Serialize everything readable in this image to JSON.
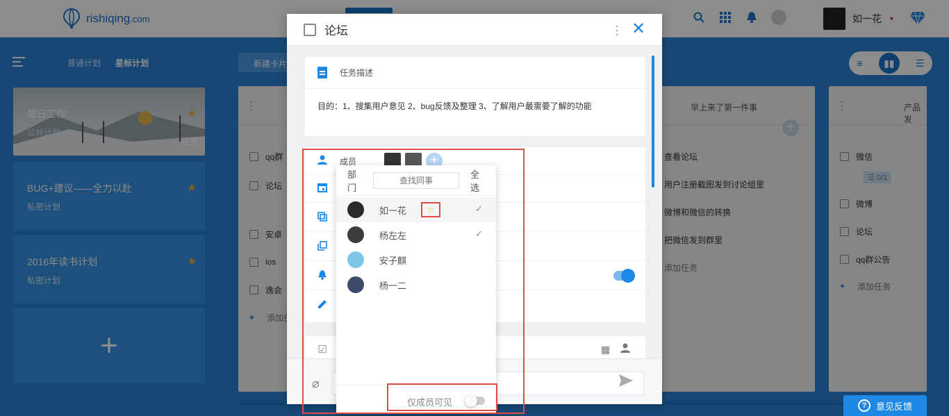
{
  "brand": {
    "name": "rishiqing",
    "suffix": ".com"
  },
  "user": {
    "name": "如一花"
  },
  "sidebar": {
    "tabs": [
      "普通计划",
      "星标计划"
    ],
    "plans": [
      {
        "title": "每日工作",
        "sub": "公共计划",
        "action": "设置"
      },
      {
        "title": "BUG+建议——全力以赴",
        "sub": "私密计划"
      },
      {
        "title": "2016年读书计划",
        "sub": "私密计划"
      }
    ],
    "add": "+"
  },
  "board": {
    "new_card": "新建卡片",
    "columns": [
      {
        "title": "",
        "tasks": [
          "qq群",
          "论坛",
          "安卓",
          "ios",
          "逸会"
        ],
        "add": "添加任务"
      },
      {
        "title": "早上来了第一件事",
        "tasks": [
          "查看论坛",
          "用户注册截图发到讨论组里",
          "微博和微信的转换",
          "把微信发到群里"
        ],
        "add": "添加任务"
      },
      {
        "title": "产品发",
        "tasks": [
          "微信",
          "微博",
          "论坛",
          "qq群公告"
        ],
        "tag": "0/1",
        "add": "添加任务"
      }
    ]
  },
  "modal": {
    "title": "论坛",
    "desc_label": "任务描述",
    "desc_text": "目的：1、搜集用户意见 2、bug反馈及整理 3、了解用户最需要了解的功能",
    "member_label": "成员"
  },
  "dropdown": {
    "dept": "部门",
    "search_placeholder": "查找同事",
    "select_all": "全选",
    "members": [
      {
        "name": "如一花",
        "checked": true,
        "star": true,
        "avatar_color": "#2a2a2a"
      },
      {
        "name": "杨左左",
        "checked": true,
        "star": false,
        "avatar_color": "#3b3b3b"
      },
      {
        "name": "安子麒",
        "checked": false,
        "star": false,
        "avatar_color": "#7ec6e8"
      },
      {
        "name": "杨一二",
        "checked": false,
        "star": false,
        "avatar_color": "#3c4c6a"
      }
    ],
    "only_members": "仅成员可见"
  },
  "feedback": "意见反馈"
}
